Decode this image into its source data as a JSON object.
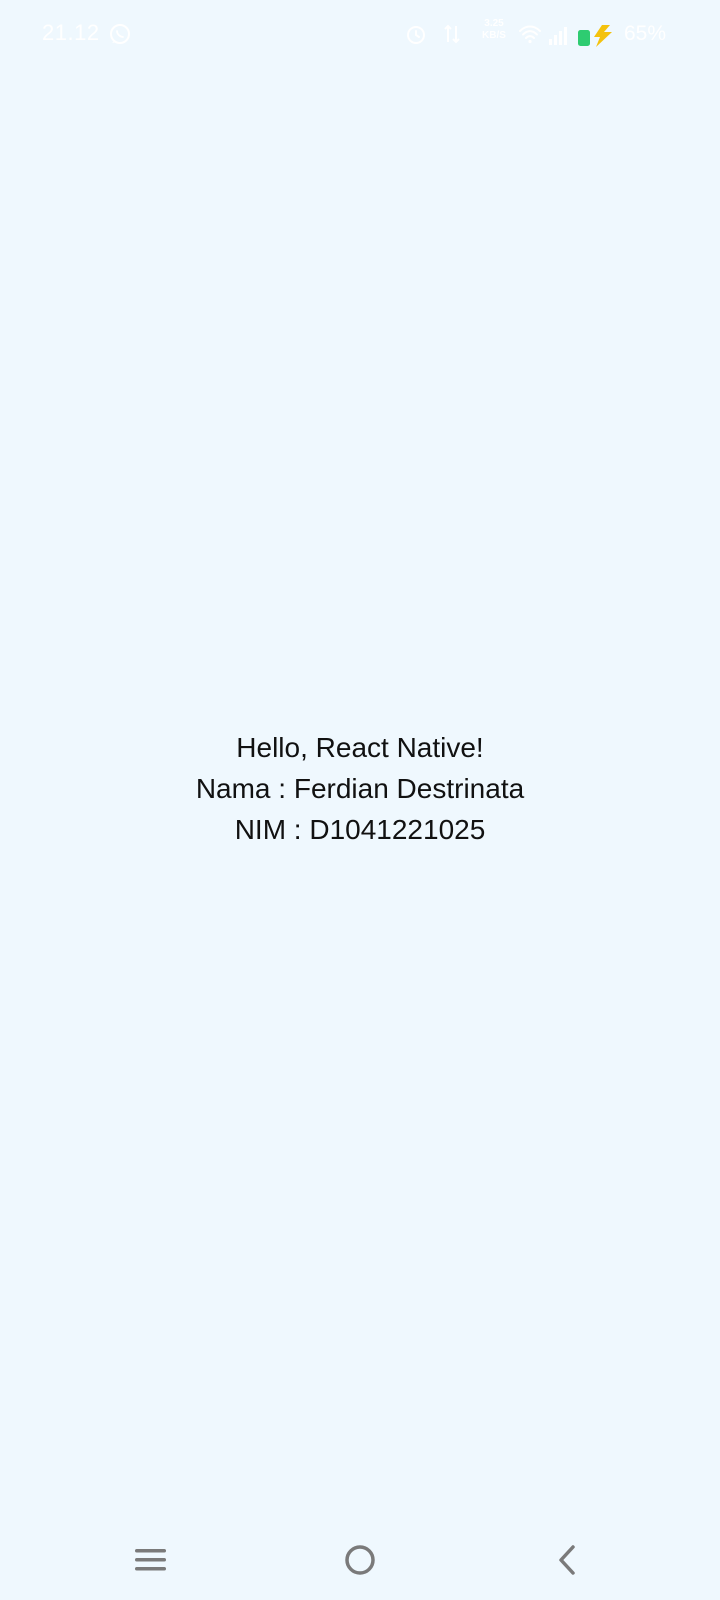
{
  "status_bar": {
    "time": "21.12",
    "network_speed_top": "3.25",
    "network_speed_bottom": "KB/S",
    "battery_percent": "65%",
    "icons": [
      "whatsapp-icon",
      "alarm-icon",
      "data-transfer-icon",
      "wifi-icon",
      "signal-icon",
      "battery-icon",
      "charging-bolt-icon"
    ],
    "colors": {
      "battery_fill": "#2ecc71",
      "charging_bolt": "#f4c20d"
    }
  },
  "main": {
    "greeting": "Hello, React Native!",
    "name_line": "Nama : Ferdian Destrinata",
    "nim_line": "NIM : D1041221025"
  },
  "navigation_bar": {
    "icons": [
      "menu-icon",
      "home-circle-icon",
      "back-chevron-icon"
    ]
  },
  "colors": {
    "background": "#eff8fe",
    "text": "#111111",
    "nav_icons": "#7a7a7a"
  }
}
